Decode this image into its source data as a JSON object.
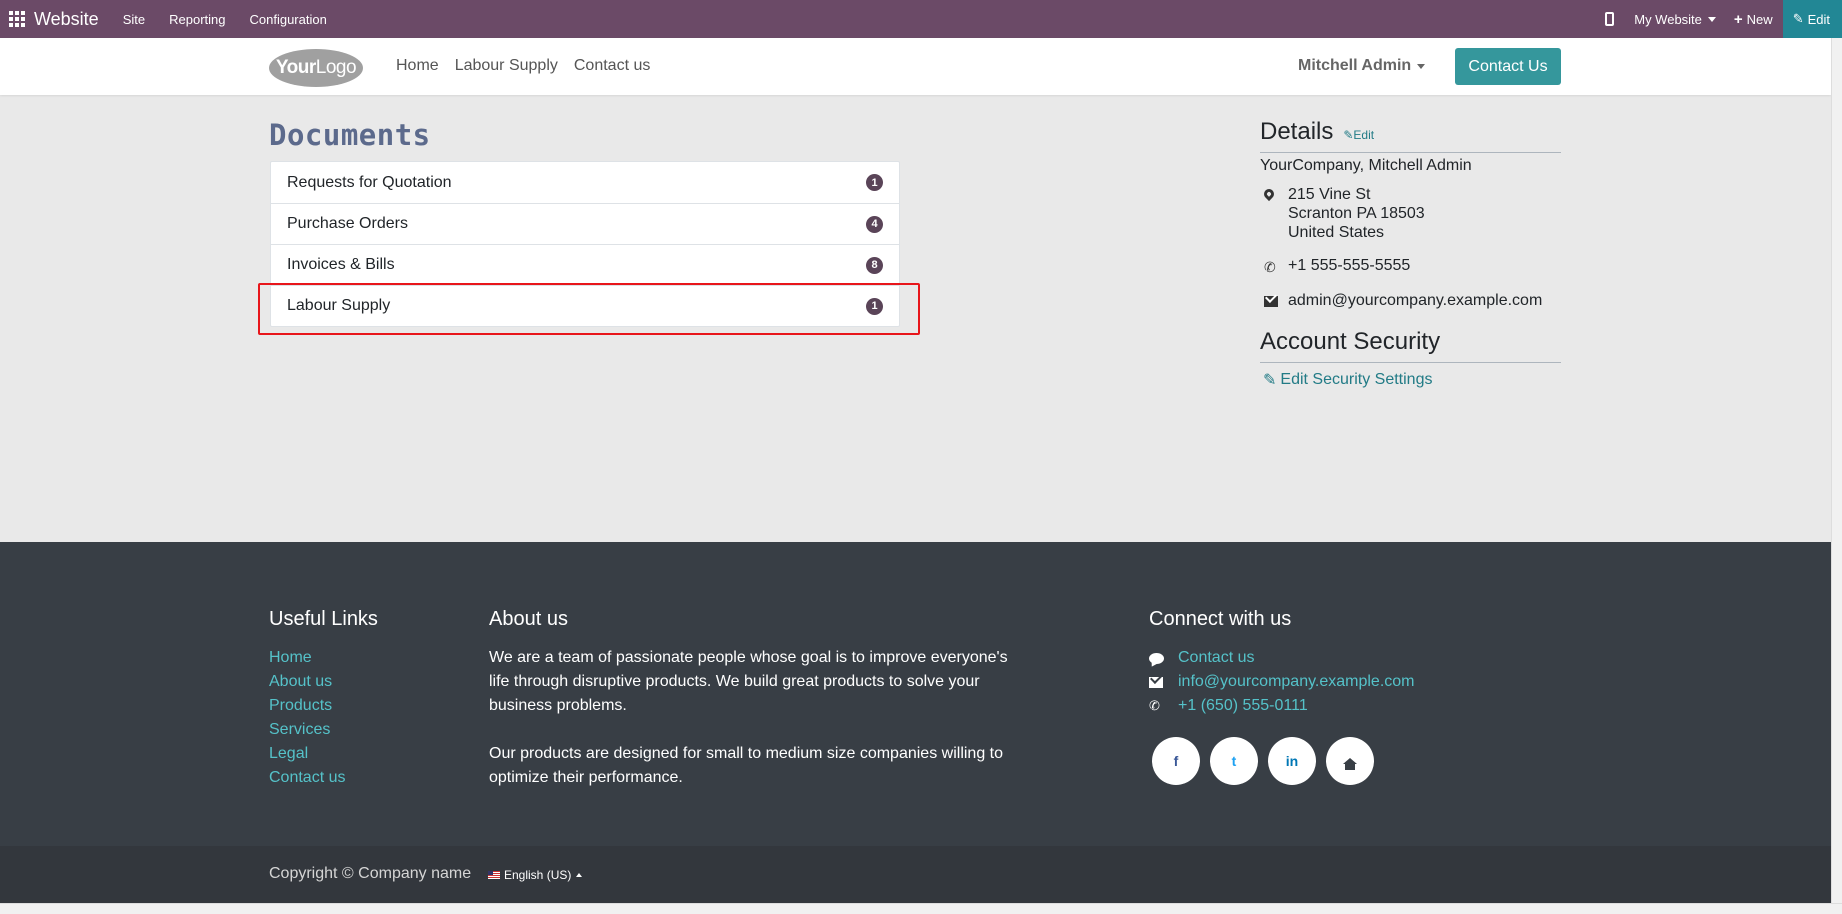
{
  "adminbar": {
    "brand": "Website",
    "menu": [
      "Site",
      "Reporting",
      "Configuration"
    ],
    "site_select": "My Website",
    "new_label": "New",
    "edit_label": "Edit"
  },
  "header": {
    "logo_bold": "Your",
    "logo_rest": "Logo",
    "nav": [
      "Home",
      "Labour Supply",
      "Contact us"
    ],
    "user": "Mitchell Admin",
    "contact_button": "Contact Us"
  },
  "documents": {
    "title": "Documents",
    "rows": [
      {
        "label": "Requests for Quotation",
        "count": "1"
      },
      {
        "label": "Purchase Orders",
        "count": "4"
      },
      {
        "label": "Invoices & Bills",
        "count": "8"
      },
      {
        "label": "Labour Supply",
        "count": "1"
      }
    ]
  },
  "details": {
    "title": "Details",
    "edit_label": "Edit",
    "company": "YourCompany, Mitchell Admin",
    "address": [
      "215 Vine St",
      "Scranton PA 18503",
      "United States"
    ],
    "phone": "+1 555-555-5555",
    "email": "admin@yourcompany.example.com",
    "security_title": "Account Security",
    "security_link": "Edit Security Settings"
  },
  "footer": {
    "useful_links_title": "Useful Links",
    "useful_links": [
      "Home",
      "About us",
      "Products",
      "Services",
      "Legal",
      "Contact us"
    ],
    "about_title": "About us",
    "about_p1": "We are a team of passionate people whose goal is to improve everyone's life through disruptive products. We build great products to solve your business problems.",
    "about_p2": "Our products are designed for small to medium size companies willing to optimize their performance.",
    "connect_title": "Connect with us",
    "connect_contact": "Contact us",
    "connect_email": "info@yourcompany.example.com",
    "connect_phone": "+1 (650) 555-0111",
    "social": {
      "facebook": "f",
      "twitter": "t",
      "linkedin": "in"
    },
    "copyright": "Copyright © Company name",
    "language": "English (US)"
  },
  "colors": {
    "adminbar": "#6b4a67",
    "accent": "#35979c",
    "highlight": "#e8161b",
    "footer": "#383e45"
  }
}
